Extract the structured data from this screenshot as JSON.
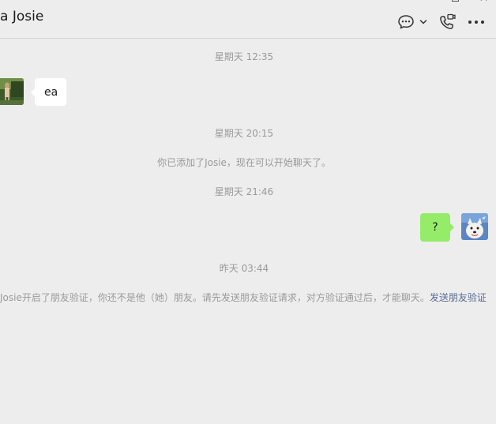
{
  "header": {
    "title": "a Josie",
    "icons": {
      "chat": "chat-bubble-icon",
      "dropdown": "chevron-down-icon",
      "call": "phone-video-icon",
      "more": "more-dots-icon"
    }
  },
  "messages": {
    "ts1": "星期天 12:35",
    "msg1": {
      "text": "ea",
      "sender": "contact"
    },
    "ts2": "星期天 20:15",
    "sys1": "你已添加了Josie，现在可以开始聊天了。",
    "ts3": "星期天 21:46",
    "msg2": {
      "text": "?",
      "sender": "self"
    },
    "ts4": "昨天 03:44",
    "sys2": {
      "text": "Josie开启了朋友验证，你还不是他（她）朋友。请先发送朋友验证请求，对方验证通过后，才能聊天。",
      "link": "发送朋友验证"
    }
  },
  "colors": {
    "background": "#ededed",
    "bubble_in": "#ffffff",
    "bubble_out": "#95ec69",
    "link": "#576b95",
    "system_text": "#9a9a9a"
  }
}
